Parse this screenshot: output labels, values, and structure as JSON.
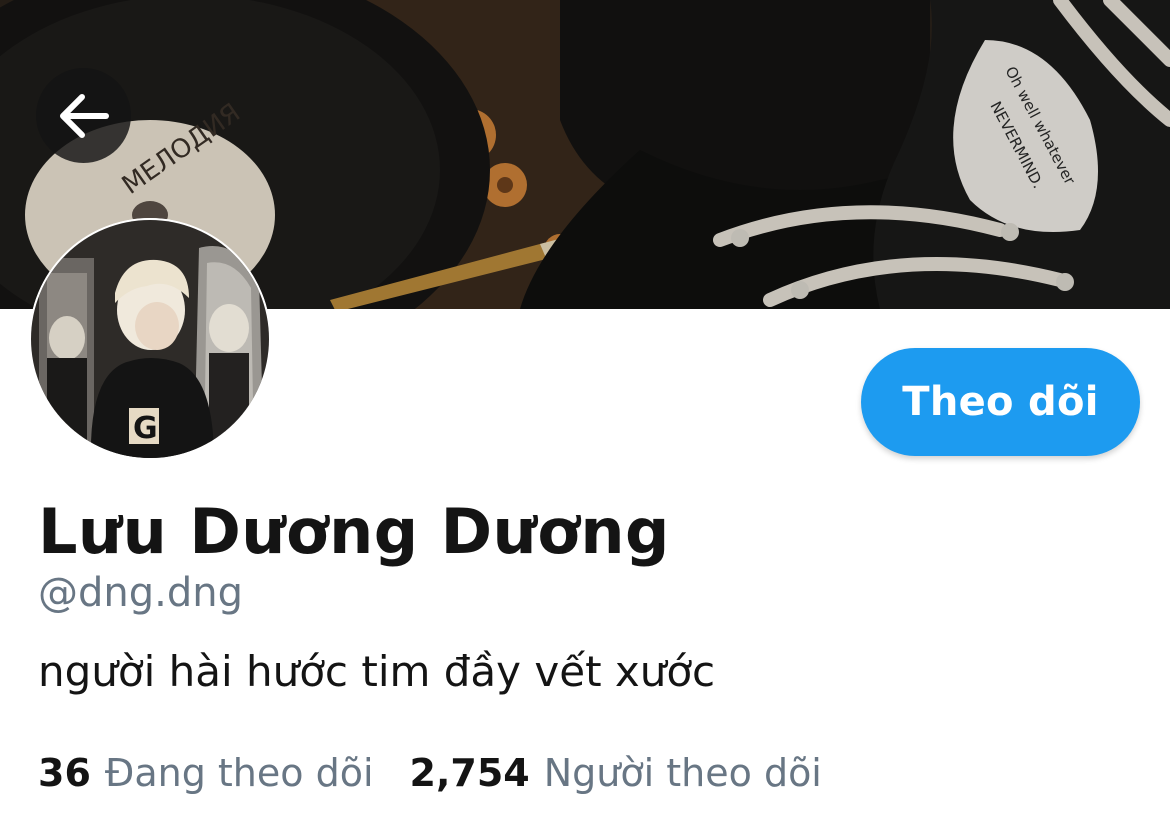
{
  "profile": {
    "display_name": "Lưu Dương Dương",
    "handle": "@dng.dng",
    "bio": "người hài hước tim đầy vết xước"
  },
  "actions": {
    "follow_label": "Theo dõi"
  },
  "stats": {
    "following_count": "36",
    "following_label": "Đang theo dõi",
    "followers_count": "2,754",
    "followers_label": "Người theo dõi"
  },
  "banner": {
    "record_label_text": "МЕЛОДИЯ",
    "shoe_text_line1": "Oh well whatever",
    "shoe_text_line2": "NEVERMIND."
  },
  "avatar": {
    "shirt_letter": "G"
  },
  "icons": {
    "back": "arrow-left-icon"
  },
  "colors": {
    "accent": "#1d9bf0",
    "primary_text": "#141414",
    "secondary_text": "#687684"
  }
}
